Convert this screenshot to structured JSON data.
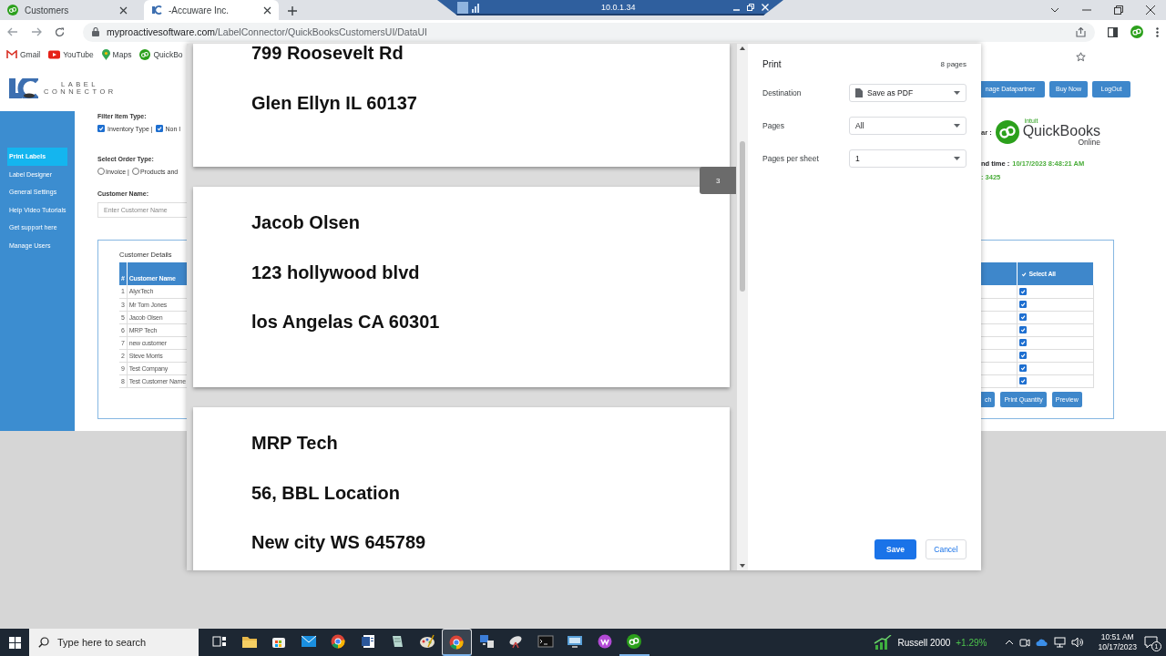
{
  "browser": {
    "tabs": [
      {
        "title": "Customers",
        "selected": false
      },
      {
        "title": "-Accuware Inc.",
        "selected": true
      }
    ],
    "url_host": "myproactivesoftware.com",
    "url_path": "/LabelConnector/QuickBooksCustomersUI/DataUI",
    "bookmarks": [
      "Gmail",
      "YouTube",
      "Maps",
      "QuickBo"
    ]
  },
  "remote_bar": {
    "title": "10.0.1.34"
  },
  "app": {
    "logo": {
      "line1": "LABEL",
      "line2": "CONNECTOR"
    },
    "header_buttons": [
      "nage Datapartner",
      "Buy Now",
      "LogOut"
    ],
    "sidebar": [
      {
        "label": "Print Labels",
        "selected": true
      },
      {
        "label": "Label Designer",
        "selected": false
      },
      {
        "label": "General Settings",
        "selected": false
      },
      {
        "label": "Help Video Tutorials",
        "selected": false
      },
      {
        "label": "Get support here",
        "selected": false
      },
      {
        "label": "Manage Users",
        "selected": false
      }
    ],
    "filter": {
      "label": "Filter Item Type:",
      "options": [
        {
          "label": "Inventory Type |",
          "checked": true
        },
        {
          "label": "Non I",
          "checked": true
        }
      ]
    },
    "order_type": {
      "label": "Select Order Type:",
      "options": [
        {
          "label": "Invoice |",
          "selected": false
        },
        {
          "label": "Products and",
          "selected": false
        }
      ]
    },
    "customer_name": {
      "label": "Customer Name:",
      "placeholder": "Enter Customer Name"
    },
    "quickbooks": {
      "label": "ar :",
      "brand_top": "intuit",
      "brand": "QuickBooks",
      "brand_sub": "Online"
    },
    "sync": {
      "label": "nd time :",
      "value": "10/17/2023 8:48:21 AM"
    },
    "count": ": 3425",
    "details": {
      "title": "Customer Details",
      "columns": [
        "#",
        "Customer Name"
      ],
      "select_all": {
        "label": "Select All",
        "checked": true
      },
      "rows": [
        {
          "num": "1",
          "name": "AlyxTech",
          "checked": true
        },
        {
          "num": "3",
          "name": "Mr Tom Jones",
          "checked": true
        },
        {
          "num": "5",
          "name": "Jacob Olsen",
          "checked": true
        },
        {
          "num": "6",
          "name": "MRP Tech",
          "checked": true
        },
        {
          "num": "7",
          "name": "new customer",
          "checked": true
        },
        {
          "num": "2",
          "name": "Steve Morris",
          "checked": true
        },
        {
          "num": "9",
          "name": "Test Company",
          "checked": true
        },
        {
          "num": "8",
          "name": "Test Customer Name",
          "checked": true
        }
      ]
    },
    "action_buttons": [
      "ch",
      "Print Quantity",
      "Preview"
    ]
  },
  "print_dialog": {
    "pages": [
      {
        "lines": [
          "799 Roosevelt Rd",
          "Glen Ellyn IL 60137"
        ]
      },
      {
        "lines": [
          "Jacob Olsen",
          "123 hollywood blvd",
          "los Angelas CA 60301"
        ]
      },
      {
        "lines": [
          "MRP Tech",
          "56, BBL Location",
          "New city WS 645789"
        ]
      }
    ],
    "page_indicator": "3",
    "title": "Print",
    "page_count": "8 pages",
    "settings": [
      {
        "label": "Destination",
        "value": "Save as PDF",
        "kind": "destination"
      },
      {
        "label": "Pages",
        "value": "All",
        "kind": "plain"
      },
      {
        "label": "Pages per sheet",
        "value": "1",
        "kind": "plain"
      }
    ],
    "save": "Save",
    "cancel": "Cancel"
  },
  "taskbar": {
    "search_placeholder": "Type here to search",
    "apps": [
      {
        "kind": "taskview",
        "selected": false,
        "running": false
      },
      {
        "kind": "folder",
        "selected": false,
        "running": false
      },
      {
        "kind": "store",
        "selected": false,
        "running": false
      },
      {
        "kind": "mail",
        "selected": false,
        "running": false
      },
      {
        "kind": "chrome",
        "selected": false,
        "running": false
      },
      {
        "kind": "word",
        "selected": false,
        "running": false
      },
      {
        "kind": "note",
        "selected": false,
        "running": false
      },
      {
        "kind": "palette",
        "selected": false,
        "running": false
      },
      {
        "kind": "chrome",
        "selected": true,
        "running": true
      },
      {
        "kind": "network",
        "selected": false,
        "running": false
      },
      {
        "kind": "satellite",
        "selected": false,
        "running": false
      },
      {
        "kind": "terminal",
        "selected": false,
        "running": false
      },
      {
        "kind": "monitor",
        "selected": false,
        "running": false
      },
      {
        "kind": "wps",
        "selected": false,
        "running": false
      },
      {
        "kind": "qb",
        "selected": false,
        "running": true
      }
    ],
    "widget": {
      "name": "Russell 2000",
      "change": "+1.29%"
    },
    "time": "10:51 AM",
    "date": "10/17/2023",
    "notifications": "1"
  }
}
